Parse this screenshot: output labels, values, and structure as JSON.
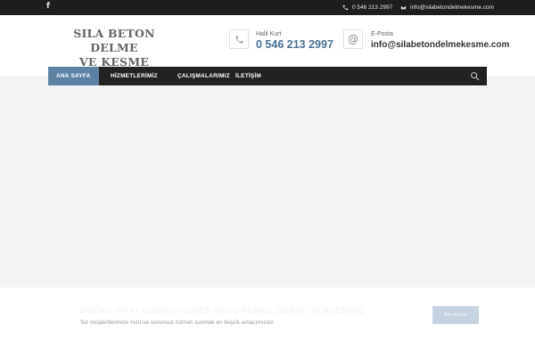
{
  "topbar": {
    "facebook_glyph": "f",
    "phone": "0 546 213 2997",
    "email": "info@silabetondelmekesme.com"
  },
  "brand": {
    "line1": "SILA BETON DELME",
    "line2": "VE KESME"
  },
  "contact": {
    "phone_label": "Halil Kurt",
    "phone_value": "0 546 213 2997",
    "email_label": "E-Posta",
    "email_value": "info@silabetondelmekesme.com",
    "email_glyph": "@"
  },
  "nav": {
    "items": [
      {
        "label": "ANA SAYFA",
        "active": true
      },
      {
        "label": "HİZMETLERİMİZ",
        "active": false
      },
      {
        "label": "ÇALIŞMALARIMIZ",
        "active": false
      },
      {
        "label": "İLETİŞİM",
        "active": false
      }
    ]
  },
  "footer_band": {
    "title": "DOĞRU FİYAT DOĞRU HİZMET ARIYORSANIZ DOĞRU YERDESİNİZ",
    "subtitle": "Siz müşterilerimize hızlı ve sorunsuz hizmet sunmak en büyük amacımızdır.",
    "button_label": "Bizi Arayın"
  },
  "icons": {
    "facebook": "facebook-icon",
    "phone": "phone-icon",
    "mail": "mail-icon",
    "search": "search-icon"
  },
  "colors": {
    "accent": "#5d82a4",
    "topbar": "#1e1e1e",
    "nav": "#222222",
    "hero": "#f3f3f3"
  }
}
